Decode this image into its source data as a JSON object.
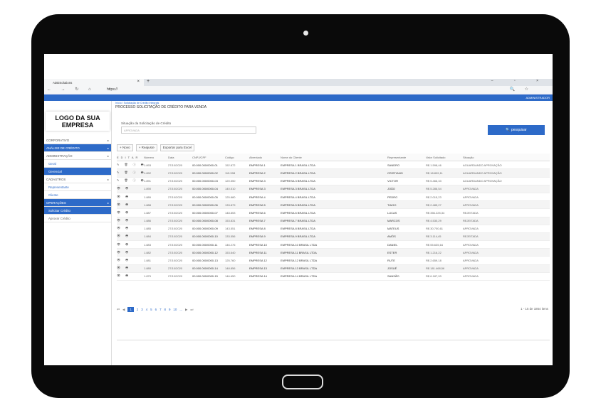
{
  "browser": {
    "tab_title": "ADDSolutions",
    "tab_close": "×",
    "new_tab": "+",
    "window_controls": "–   ▫   ×",
    "nav_glyphs": "←  →  ↻  ⌂",
    "url": "https://",
    "right_glyphs": "🔍  ☆"
  },
  "appbar": {
    "user_label": "ADMINISTRADOR"
  },
  "sidebar": {
    "logo": "LOGO DA SUA EMPRESA",
    "items": [
      {
        "label": "CORPORATIVO",
        "style": "plain"
      },
      {
        "label": "ANÁLISE DE CRÉDITO",
        "style": "blue"
      },
      {
        "label": "ADMINISTRAÇÃO",
        "style": "plain"
      },
      {
        "label": "Geral",
        "style": "sub"
      },
      {
        "label": "Gerencial",
        "style": "sel"
      },
      {
        "label": "CADASTROS",
        "style": "plain"
      },
      {
        "label": "Representante",
        "style": "sub"
      },
      {
        "label": "Cliente",
        "style": "sub"
      },
      {
        "label": "OPERAÇÕES",
        "style": "blue"
      },
      {
        "label": "Solicitar Crédito",
        "style": "sel"
      },
      {
        "label": "Aprovar Crédito",
        "style": "subg"
      }
    ]
  },
  "content": {
    "breadcrumb": "Início  /  Solicitação de Crédito Integrais",
    "title": "PROCESSO SOLICITAÇÃO DE CRÉDITO PARA VENDA",
    "filter_label": "Situação da Solicitação de Crédito",
    "filter_placeholder": "APROVADA",
    "search_button": "🔍 pesquisar",
    "toolbar": {
      "new": "+ Novo",
      "readjust": "+ Reajuste",
      "export": "Exportar para Excel"
    }
  },
  "table": {
    "headers": [
      "EDITAR",
      "Número",
      "Data",
      "CNPJ/CPF",
      "Código",
      "Abreviado",
      "Nome do Cliente",
      "Representante",
      "Valor Solicitado",
      "Situação"
    ],
    "rows": [
      {
        "acts": "✎ 🗑 ⓘ 🖶",
        "num": "1.893",
        "date": "27/10/2020",
        "cnpj": "00.000.000/0000-01",
        "cod": "152.872",
        "abr": "EMPRESA 1",
        "nome": "EMPRESA 1 BRASIL LTDA",
        "rep": "SANDRO",
        "val": "R$ 1.598,46",
        "sit": "AGUARDANDO APROVAÇÃO"
      },
      {
        "acts": "✎ 🗑 ⓘ 🖶",
        "num": "1.892",
        "date": "27/10/2020",
        "cnpj": "00.000.000/0000-02",
        "cod": "115.598",
        "abr": "EMPRESA 2",
        "nome": "EMPRESA 2 BRASIL LTDA",
        "rep": "CRISTIANO",
        "val": "R$ 18.809,11",
        "sit": "AGUARDANDO APROVAÇÃO"
      },
      {
        "acts": "✎ 🗑 ⓘ 🖶",
        "num": "1.891",
        "date": "27/10/2020",
        "cnpj": "00.000.000/0000-03",
        "cod": "120.550",
        "abr": "EMPRESA 3",
        "nome": "EMPRESA 3 BRASIL LTDA",
        "rep": "VICTOR",
        "val": "R$ 5.466,33",
        "sit": "AGUARDANDO APROVAÇÃO"
      },
      {
        "acts": "👁 🖶",
        "num": "1.890",
        "date": "27/10/2020",
        "cnpj": "00.000.000/0000-04",
        "cod": "140.510",
        "abr": "EMPRESA 3",
        "nome": "EMPRESA 3 BRASIL LTDA",
        "rep": "JOÃO",
        "val": "R$ 5.286,54",
        "sit": "APROVADA"
      },
      {
        "acts": "👁 🖶",
        "num": "1.889",
        "date": "27/10/2020",
        "cnpj": "00.000.000/0000-05",
        "cod": "125.880",
        "abr": "EMPRESA 4",
        "nome": "EMPRESA 4 BRASIL LTDA",
        "rep": "PEDRO",
        "val": "R$ 2.015,23",
        "sit": "APROVADA"
      },
      {
        "acts": "👁 🖶",
        "num": "1.888",
        "date": "27/10/2020",
        "cnpj": "00.000.000/0000-06",
        "cod": "133.879",
        "abr": "EMPRESA 5",
        "nome": "EMPRESA 5 BRASIL LTDA",
        "rep": "TIAGO",
        "val": "R$ 2.485,27",
        "sit": "APROVADA"
      },
      {
        "acts": "👁 🖶",
        "num": "1.887",
        "date": "27/10/2020",
        "cnpj": "00.000.000/0000-07",
        "cod": "148.853",
        "abr": "EMPRESA 6",
        "nome": "EMPRESA 6 BRASIL LTDA",
        "rep": "LUCAS",
        "val": "R$ 356.225,34",
        "sit": "REJEITADA"
      },
      {
        "acts": "👁 🖶",
        "num": "1.886",
        "date": "27/10/2020",
        "cnpj": "00.000.000/0000-08",
        "cod": "153.831",
        "abr": "EMPRESA 7",
        "nome": "EMPRESA 7 BRASIL LTDA",
        "rep": "MARCOS",
        "val": "R$ 4.530,29",
        "sit": "REJEITADA"
      },
      {
        "acts": "👁 🖶",
        "num": "1.885",
        "date": "27/10/2020",
        "cnpj": "00.000.000/0000-09",
        "cod": "143.551",
        "abr": "EMPRESA 8",
        "nome": "EMPRESA 8 BRASIL LTDA",
        "rep": "MATEUS",
        "val": "R$ 30.700,61",
        "sit": "APROVADA"
      },
      {
        "acts": "👁 🖶",
        "num": "1.884",
        "date": "27/10/2020",
        "cnpj": "00.000.000/0000-10",
        "cod": "133.556",
        "abr": "EMPRESA 9",
        "nome": "EMPRESA 9 BRASIL LTDA",
        "rep": "AMÓS",
        "val": "R$ 3.114,45",
        "sit": "REJEITADA"
      },
      {
        "acts": "👁 🖶",
        "num": "1.883",
        "date": "27/10/2020",
        "cnpj": "00.000.000/0000-11",
        "cod": "146.276",
        "abr": "EMPRESA 10",
        "nome": "EMPRESA 10 BRASIL LTDA",
        "rep": "DANIEL",
        "val": "R$ 55.635,64",
        "sit": "APROVADA"
      },
      {
        "acts": "👁 🖶",
        "num": "1.882",
        "date": "27/10/2020",
        "cnpj": "00.000.000/0000-12",
        "cod": "153.640",
        "abr": "EMPRESA 11",
        "nome": "EMPRESA 11 BRASIL LTDA",
        "rep": "ESTER",
        "val": "R$ 1.216,22",
        "sit": "APROVADA"
      },
      {
        "acts": "👁 🖶",
        "num": "1.881",
        "date": "27/10/2020",
        "cnpj": "00.000.000/0000-13",
        "cod": "125.760",
        "abr": "EMPRESA 12",
        "nome": "EMPRESA 12 BRASIL LTDA",
        "rep": "RUTE",
        "val": "R$ 2.659,18",
        "sit": "APROVADA"
      },
      {
        "acts": "👁 🖶",
        "num": "1.880",
        "date": "27/10/2020",
        "cnpj": "00.000.000/0000-14",
        "cod": "148.856",
        "abr": "EMPRESA 13",
        "nome": "EMPRESA 13 BRASIL LTDA",
        "rep": "JOSUÉ",
        "val": "R$ 181.468,56",
        "sit": "APROVADA"
      },
      {
        "acts": "👁 🖶",
        "num": "1.879",
        "date": "27/10/2020",
        "cnpj": "00.000.000/0000-15",
        "cod": "146.650",
        "abr": "EMPRESA 14",
        "nome": "EMPRESA 14 BRASIL LTDA",
        "rep": "SANSÃO",
        "val": "R$ 6.187,93",
        "sit": "APROVADA"
      }
    ]
  },
  "pager": {
    "first": "⏮",
    "prev": "◀",
    "pages": [
      "1",
      "2",
      "3",
      "4",
      "5",
      "6",
      "7",
      "8",
      "9",
      "10",
      "..."
    ],
    "next": "▶",
    "last": "⏭",
    "count": "1 - 15 de 1864 itens"
  },
  "colors": {
    "accent": "#2d6ac8",
    "bezel": "#0a0a0a"
  }
}
